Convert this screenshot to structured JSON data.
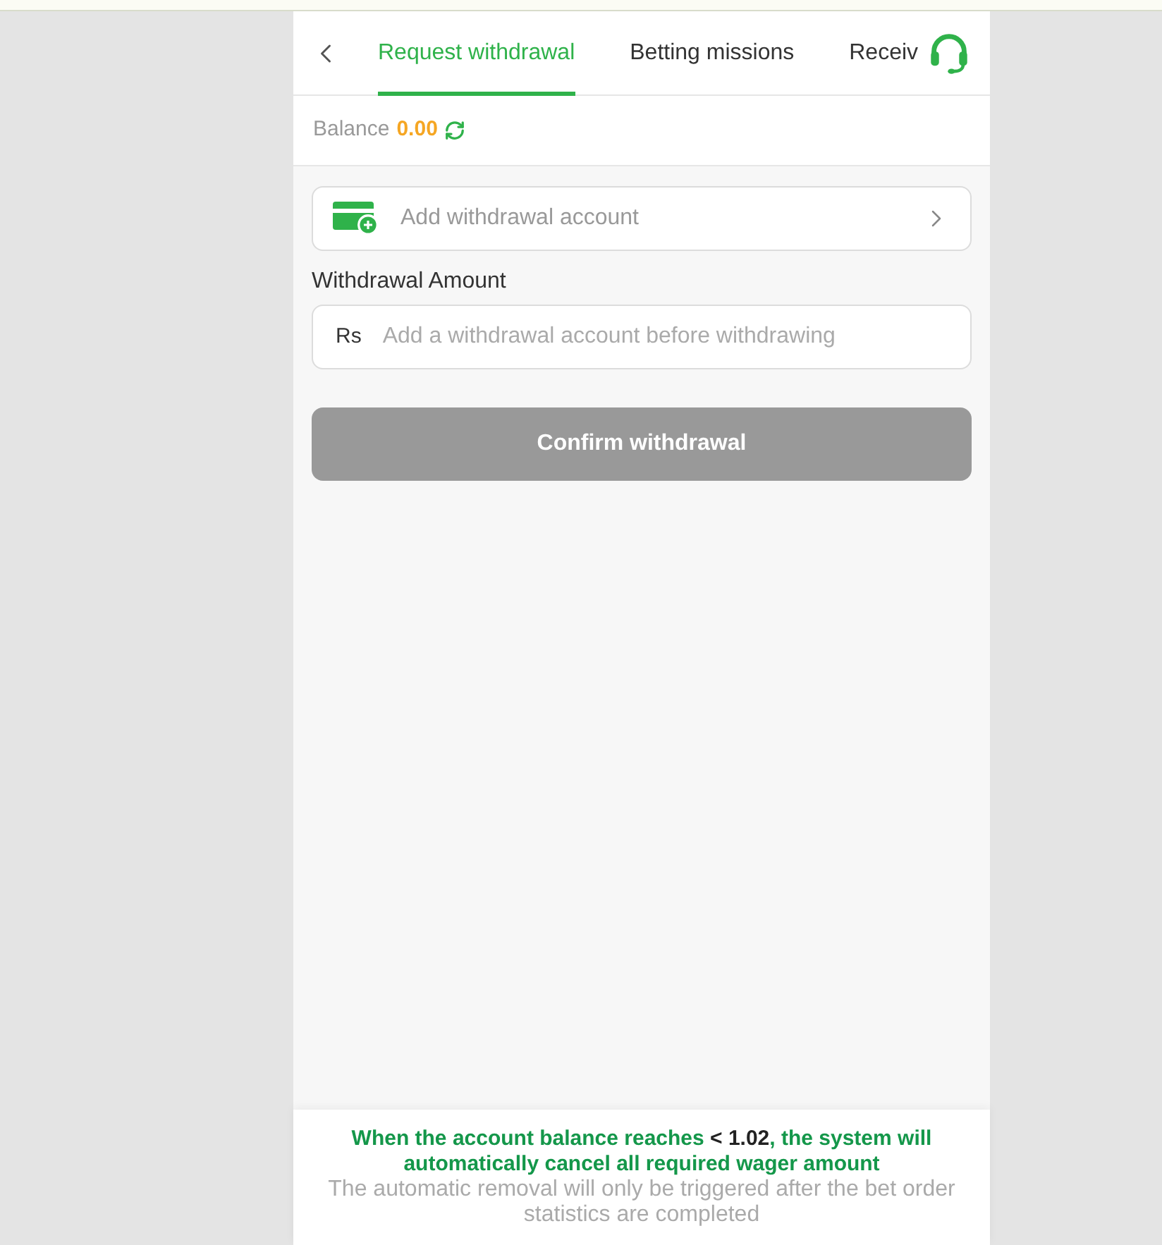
{
  "tabs": [
    {
      "label": "Request withdrawal",
      "selected": true
    },
    {
      "label": "Betting missions",
      "selected": false
    },
    {
      "label": "Receiv",
      "selected": false
    }
  ],
  "balance": {
    "label": "Balance",
    "amount": "0.00"
  },
  "account_row": {
    "label": "Add withdrawal account"
  },
  "amount": {
    "label": "Withdrawal Amount",
    "currency": "Rs",
    "placeholder": "Add a withdrawal account before withdrawing"
  },
  "confirm_button": {
    "label": "Confirm withdrawal",
    "disabled": true
  },
  "notice": {
    "text_before": "When the account balance reaches ",
    "value": "< 1.02",
    "text_after": ", the system will automatically cancel all required wager amount",
    "note": "The automatic removal will only be triggered after the bet order statistics are completed"
  }
}
